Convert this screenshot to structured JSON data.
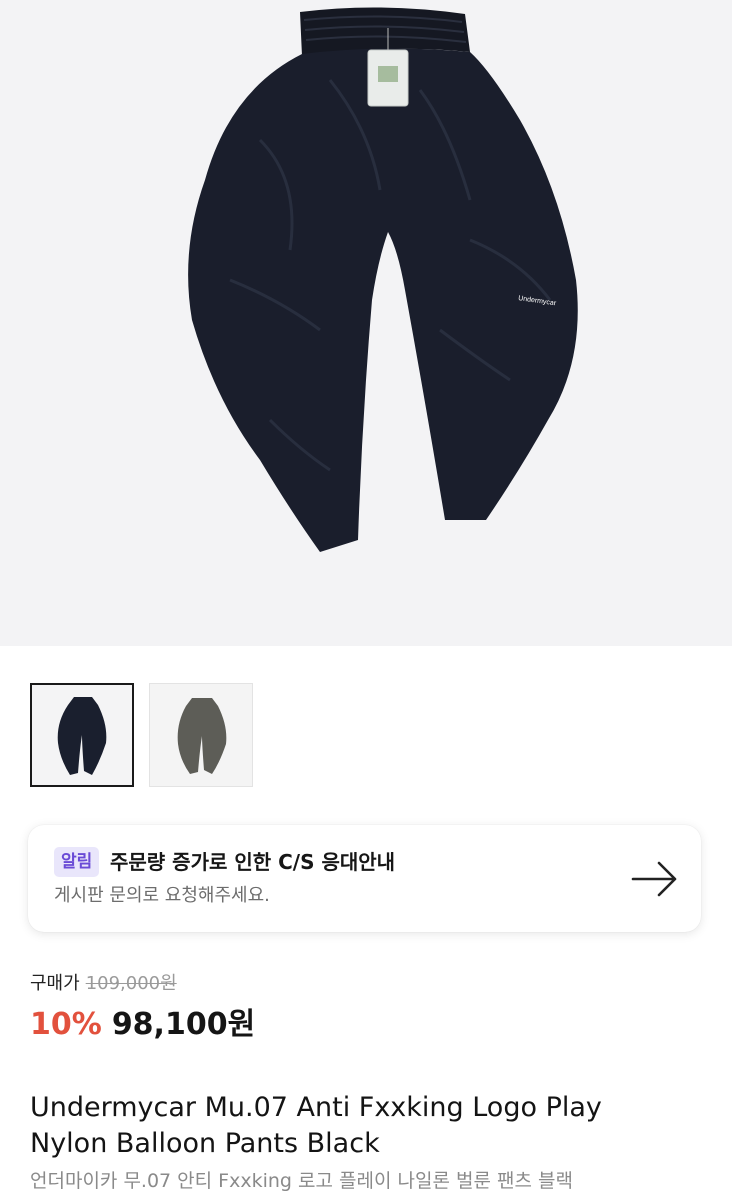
{
  "product": {
    "images": [
      {
        "name": "black-pants-thumbnail",
        "color": "#1a1f2e",
        "selected": true
      },
      {
        "name": "charcoal-pants-thumbnail",
        "color": "#5d5d57",
        "selected": false
      }
    ],
    "hero_logo_text": "Undermycar"
  },
  "notice": {
    "badge": "알림",
    "title": "주문량 증가로 인한 C/S 응대안내",
    "subtitle": "게시판 문의로 요청해주세요.",
    "icon": "arrow-right-icon"
  },
  "price": {
    "label": "구매가",
    "original": "109,000원",
    "discount": "10%",
    "final": "98,100원"
  },
  "title": {
    "line1": "Undermycar Mu.07 Anti Fxxking Logo Play",
    "line2": "Nylon Balloon Pants Black",
    "korean": "언더마이카 무.07 안티 Fxxking 로고 플레이 나일론 벌룬 팬츠 블랙"
  },
  "colors": {
    "accent": "#6a4bd6",
    "discount": "#e2513d",
    "hero_bg": "#f3f3f5"
  }
}
